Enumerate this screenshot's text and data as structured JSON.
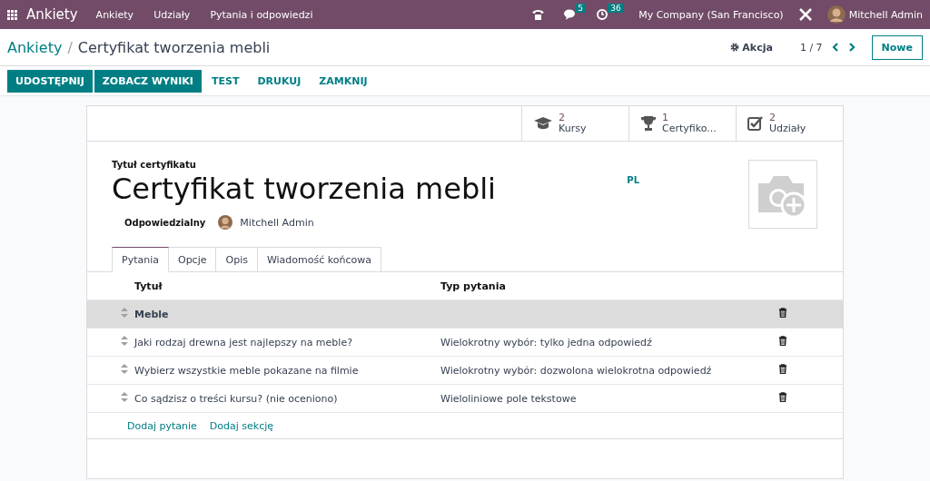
{
  "navbar": {
    "app": "Ankiety",
    "menu": [
      "Ankiety",
      "Udziały",
      "Pytania i odpowiedzi"
    ],
    "messages_count": "5",
    "activities_count": "36",
    "company": "My Company (San Francisco)",
    "user": "Mitchell Admin"
  },
  "breadcrumb": {
    "parent": "Ankiety",
    "separator": "/",
    "current": "Certyfikat tworzenia mebli"
  },
  "pager": {
    "action": "Akcja",
    "position": "1 / 7",
    "new_button": "Nowe"
  },
  "actions": [
    {
      "label": "UDOSTĘPNIJ",
      "kind": "primary"
    },
    {
      "label": "ZOBACZ WYNIKI",
      "kind": "primary"
    },
    {
      "label": "TEST",
      "kind": "link"
    },
    {
      "label": "DRUKUJ",
      "kind": "link"
    },
    {
      "label": "ZAMKNIJ",
      "kind": "link"
    }
  ],
  "stat_buttons": [
    {
      "kind": "courses",
      "count": "2",
      "label": "Kursy"
    },
    {
      "kind": "certificates",
      "count": "1",
      "label": "Certyfiko..."
    },
    {
      "kind": "participations",
      "count": "2",
      "label": "Udziały"
    }
  ],
  "form": {
    "title_label": "Tytuł certyfikatu",
    "title": "Certyfikat tworzenia mebli",
    "language": "PL",
    "responsible_label": "Odpowiedzialny",
    "responsible": "Mitchell Admin"
  },
  "tabs": [
    {
      "label": "Pytania",
      "selected": true
    },
    {
      "label": "Opcje",
      "selected": false
    },
    {
      "label": "Opis",
      "selected": false
    },
    {
      "label": "Wiadomość końcowa",
      "selected": false
    }
  ],
  "table": {
    "columns": [
      "Tytuł",
      "Typ pytania"
    ],
    "rows": [
      {
        "kind": "section",
        "title": "Meble"
      },
      {
        "kind": "question",
        "title": "Jaki rodzaj drewna jest najlepszy na meble?",
        "type": "Wielokrotny wybór: tylko jedna odpowiedź"
      },
      {
        "kind": "question",
        "title": "Wybierz wszystkie meble pokazane na filmie",
        "type": "Wielokrotny wybór: dozwolona wielokrotna odpowiedź"
      },
      {
        "kind": "question",
        "title": "Co sądzisz o treści kursu? (nie oceniono)",
        "type": "Wieloliniowe pole tekstowe"
      }
    ],
    "add_links": [
      "Dodaj pytanie",
      "Dodaj sekcję"
    ]
  }
}
